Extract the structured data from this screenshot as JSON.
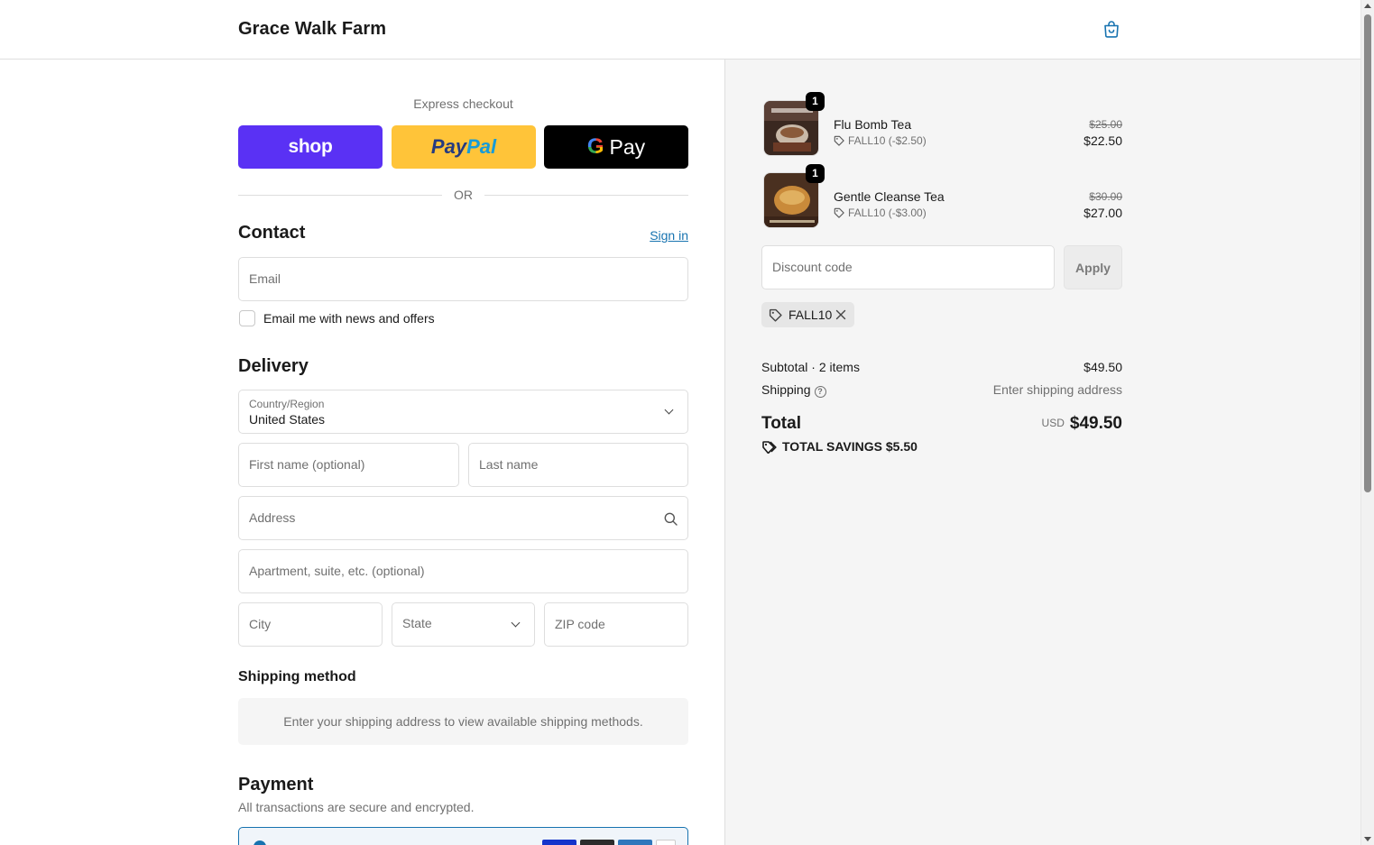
{
  "header": {
    "brand": "Grace Walk Farm",
    "cart_icon": "shopping-bag-icon"
  },
  "express": {
    "title": "Express checkout",
    "shop_label": "shop",
    "paypal_part1": "Pay",
    "paypal_part2": "Pal",
    "gpay_g": "G",
    "gpay_label": "Pay",
    "or": "OR"
  },
  "contact": {
    "heading": "Contact",
    "signin": "Sign in",
    "email_placeholder": "Email",
    "newsletter_label": "Email me with news and offers"
  },
  "delivery": {
    "heading": "Delivery",
    "country_label": "Country/Region",
    "country_value": "United States",
    "first_name_placeholder": "First name (optional)",
    "last_name_placeholder": "Last name",
    "address_placeholder": "Address",
    "apartment_placeholder": "Apartment, suite, etc. (optional)",
    "city_placeholder": "City",
    "state_placeholder": "State",
    "zip_placeholder": "ZIP code"
  },
  "shipping_method": {
    "heading": "Shipping method",
    "message": "Enter your shipping address to view available shipping methods."
  },
  "payment": {
    "heading": "Payment",
    "subtitle": "All transactions are secure and encrypted."
  },
  "summary": {
    "items": [
      {
        "name": "Flu Bomb Tea",
        "qty": "1",
        "discount": "FALL10 (-$2.50)",
        "old_price": "$25.00",
        "price": "$22.50"
      },
      {
        "name": "Gentle Cleanse Tea",
        "qty": "1",
        "discount": "FALL10 (-$3.00)",
        "old_price": "$30.00",
        "price": "$27.00"
      }
    ],
    "discount_placeholder": "Discount code",
    "apply_label": "Apply",
    "applied_code": "FALL10",
    "subtotal_label": "Subtotal · 2 items",
    "subtotal_value": "$49.50",
    "shipping_label": "Shipping",
    "shipping_value": "Enter shipping address",
    "total_label": "Total",
    "currency": "USD",
    "total_value": "$49.50",
    "savings_label": "TOTAL SAVINGS",
    "savings_value": "$5.50"
  },
  "colors": {
    "accent": "#1773b0",
    "shop": "#5a31f4",
    "paypal": "#ffc439"
  }
}
